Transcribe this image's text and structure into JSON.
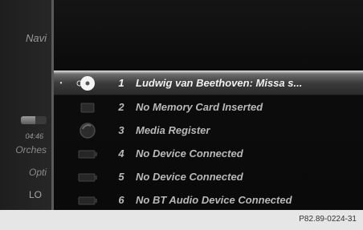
{
  "side_panel": {
    "nav_label": "Navi",
    "time": "04:46",
    "orchestra_label": "Orches",
    "options_label": "Opti",
    "lo_label": "LO",
    "progress": 0.55
  },
  "sources": [
    {
      "number": "1",
      "label": "Ludwig van Beethoven: Missa s...",
      "icon": "disc-icon",
      "selected": true,
      "bullet": "•"
    },
    {
      "number": "2",
      "label": "No Memory Card Inserted",
      "icon": "memory-card-icon",
      "selected": false,
      "bullet": ""
    },
    {
      "number": "3",
      "label": "Media Register",
      "icon": "media-register-icon",
      "selected": false,
      "bullet": ""
    },
    {
      "number": "4",
      "label": "No Device Connected",
      "icon": "device-icon",
      "selected": false,
      "bullet": ""
    },
    {
      "number": "5",
      "label": "No Device Connected",
      "icon": "device-icon",
      "selected": false,
      "bullet": ""
    },
    {
      "number": "6",
      "label": "No BT Audio Device Connected",
      "icon": "bt-audio-icon",
      "selected": false,
      "bullet": ""
    }
  ],
  "caption": {
    "code": "P82.89-0224-31"
  },
  "colors": {
    "selection": "#6e6e6e",
    "text": "#b9b9b9",
    "caption_bg": "#e6e6e6"
  }
}
